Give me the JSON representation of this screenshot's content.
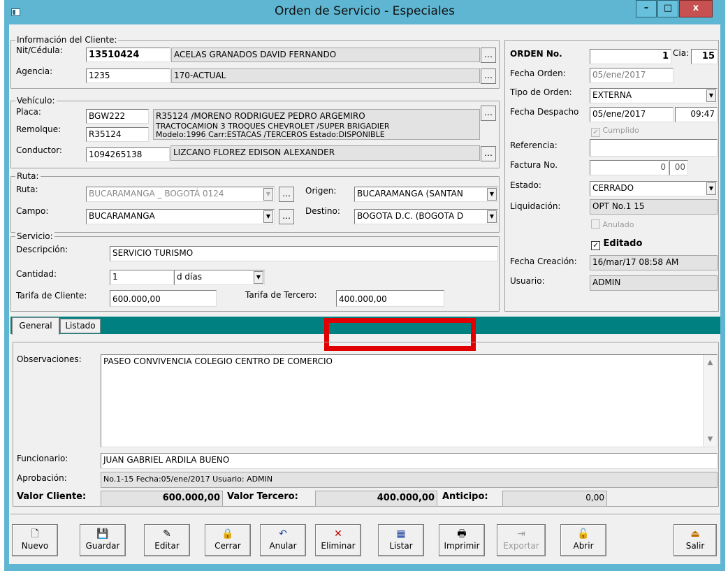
{
  "window": {
    "title": "Orden de Servicio - Especiales",
    "min": "–",
    "max": "□",
    "close": "x"
  },
  "cliente": {
    "title": "Información del Cliente:",
    "nit_label": "Nit/Cédula:",
    "nit": "13510424",
    "nombre": "ACELAS GRANADOS DAVID FERNANDO",
    "agencia_label": "Agencia:",
    "agencia": "1235",
    "agencia_desc": "170-ACTUAL"
  },
  "vehiculo": {
    "title": "Vehículo:",
    "placa_label": "Placa:",
    "placa": "BGW222",
    "placa_desc": "R35124 /MORENO RODRIGUEZ PEDRO ARGEMIRO",
    "remolque_label": "Remolque:",
    "remolque": "R35124",
    "remolque_desc1": "TRACTOCAMION 3 TROQUES CHEVROLET /SUPER BRIGADIER",
    "remolque_desc2": "Modelo:1996 Carr:ESTACAS /TERCEROS Estado:DISPONIBLE",
    "conductor_label": "Conductor:",
    "conductor": "1094265138",
    "conductor_desc": "LIZCANO FLOREZ EDISON ALEXANDER"
  },
  "ruta": {
    "title": "Ruta:",
    "ruta_label": "Ruta:",
    "ruta": "BUCARAMANGA _ BOGOTÁ 0124",
    "campo_label": "Campo:",
    "campo": "BUCARAMANGA",
    "origen_label": "Origen:",
    "origen": "BUCARAMANGA  (SANTAN",
    "destino_label": "Destino:",
    "destino": "BOGOTA D.C.  (BOGOTA D"
  },
  "servicio": {
    "title": "Servicio:",
    "desc_label": "Descripción:",
    "descripcion": "SERVICIO TURISMO",
    "cant_label": "Cantidad:",
    "cantidad": "1",
    "unidad": "d  días",
    "tarifa_cli_label": "Tarifa de Cliente:",
    "tarifa_cli": "600.000,00",
    "tarifa_ter_label": "Tarifa de Tercero:",
    "tarifa_ter": "400.000,00"
  },
  "orden": {
    "no_label": "ORDEN No.",
    "no": "1",
    "cia_label": "Cia:",
    "cia": "15",
    "fecha_label": "Fecha Orden:",
    "fecha": "05/ene/2017",
    "tipo_label": "Tipo de Orden:",
    "tipo": "EXTERNA",
    "despacho_label": "Fecha Despacho",
    "despacho_fecha": "05/ene/2017",
    "despacho_hora": "09:47",
    "cumplido": "Cumplido",
    "ref_label": "Referencia:",
    "referencia": "",
    "factura_label": "Factura No.",
    "factura": "0",
    "factura2": "00",
    "estado_label": "Estado:",
    "estado": "CERRADO",
    "liq_label": "Liquidación:",
    "liquidacion": "OPT No.1 15",
    "anulado": "Anulado",
    "editado": "Editado",
    "creacion_label": "Fecha Creación:",
    "creacion": "16/mar/17 08:58 AM",
    "usuario_label": "Usuario:",
    "usuario": "ADMIN"
  },
  "tabs": [
    {
      "label": "General"
    },
    {
      "label": "Listado"
    }
  ],
  "general": {
    "obs_label": "Observaciones:",
    "observaciones": "PASEO CONVIVENCIA COLEGIO CENTRO DE COMERCIO",
    "func_label": "Funcionario:",
    "funcionario": "JUAN GABRIEL ARDILA BUENO",
    "aprob_label": "Aprobación:",
    "aprobacion": "No.1-15 Fecha:05/ene/2017 Usuario: ADMIN",
    "vcli_label": "Valor Cliente:",
    "vcli": "600.000,00",
    "vter_label": "Valor Tercero:",
    "vter": "400.000,00",
    "anticipo_label": "Anticipo:",
    "anticipo": "0,00"
  },
  "toolbar": {
    "nuevo": "Nuevo",
    "guardar": "Guardar",
    "editar": "Editar",
    "cerrar": "Cerrar",
    "anular": "Anular",
    "eliminar": "Eliminar",
    "listar": "Listar",
    "imprimir": "Imprimir",
    "exportar": "Exportar",
    "abrir": "Abrir",
    "salir": "Salir"
  },
  "colors": {
    "titlebar": "#5fb6d2",
    "tabstrip": "#008080",
    "highlight": "#e00000",
    "close": "#c75050"
  }
}
